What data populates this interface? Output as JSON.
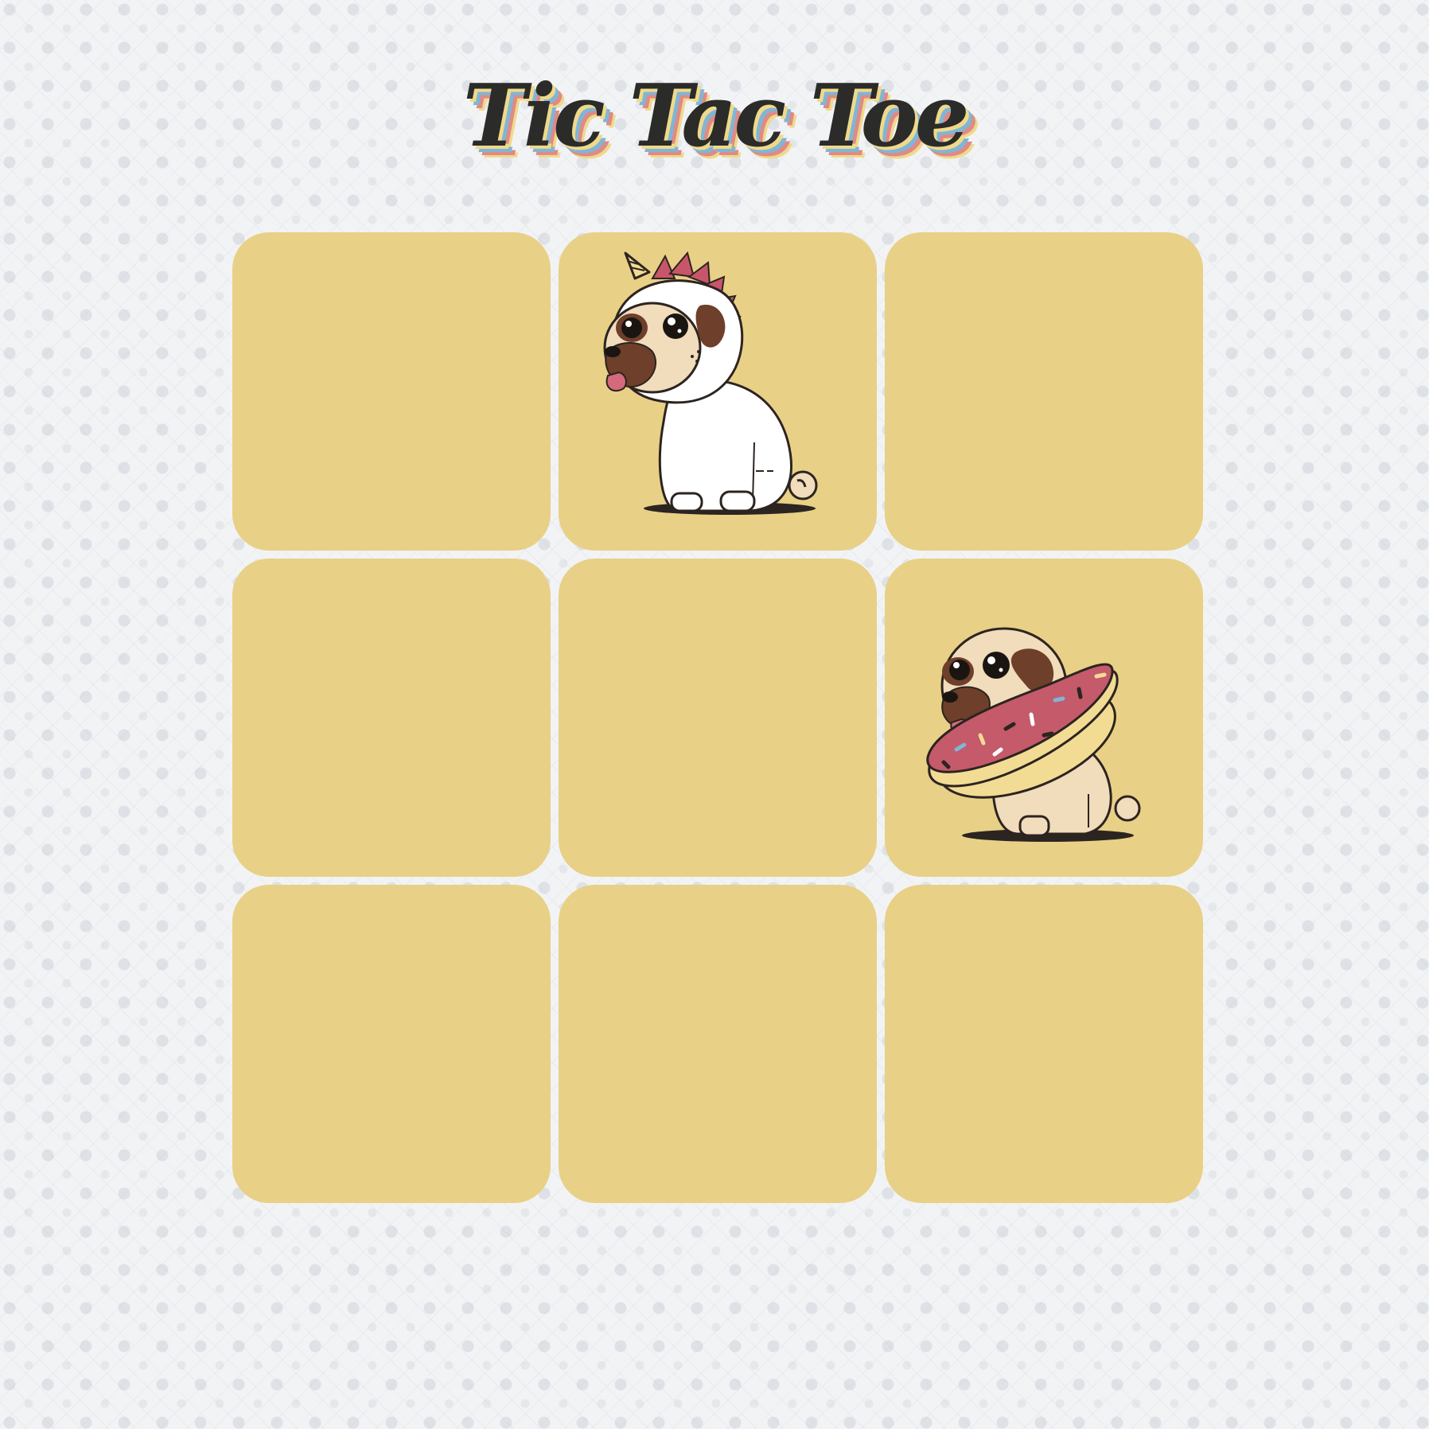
{
  "game": {
    "title": "Tic Tac Toe",
    "colors": {
      "background": "#f2f3f5",
      "cell": "#e8d086",
      "title_text": "#2b2b29",
      "title_shadow": [
        "#efd98a",
        "#7fb6d6",
        "#e08a86"
      ]
    },
    "pieces": {
      "unicorn_pug": "unicorn-pug-icon",
      "donut_pug": "donut-pug-icon"
    },
    "board": [
      "",
      "unicorn_pug",
      "",
      "",
      "",
      "donut_pug",
      "",
      "",
      ""
    ]
  }
}
